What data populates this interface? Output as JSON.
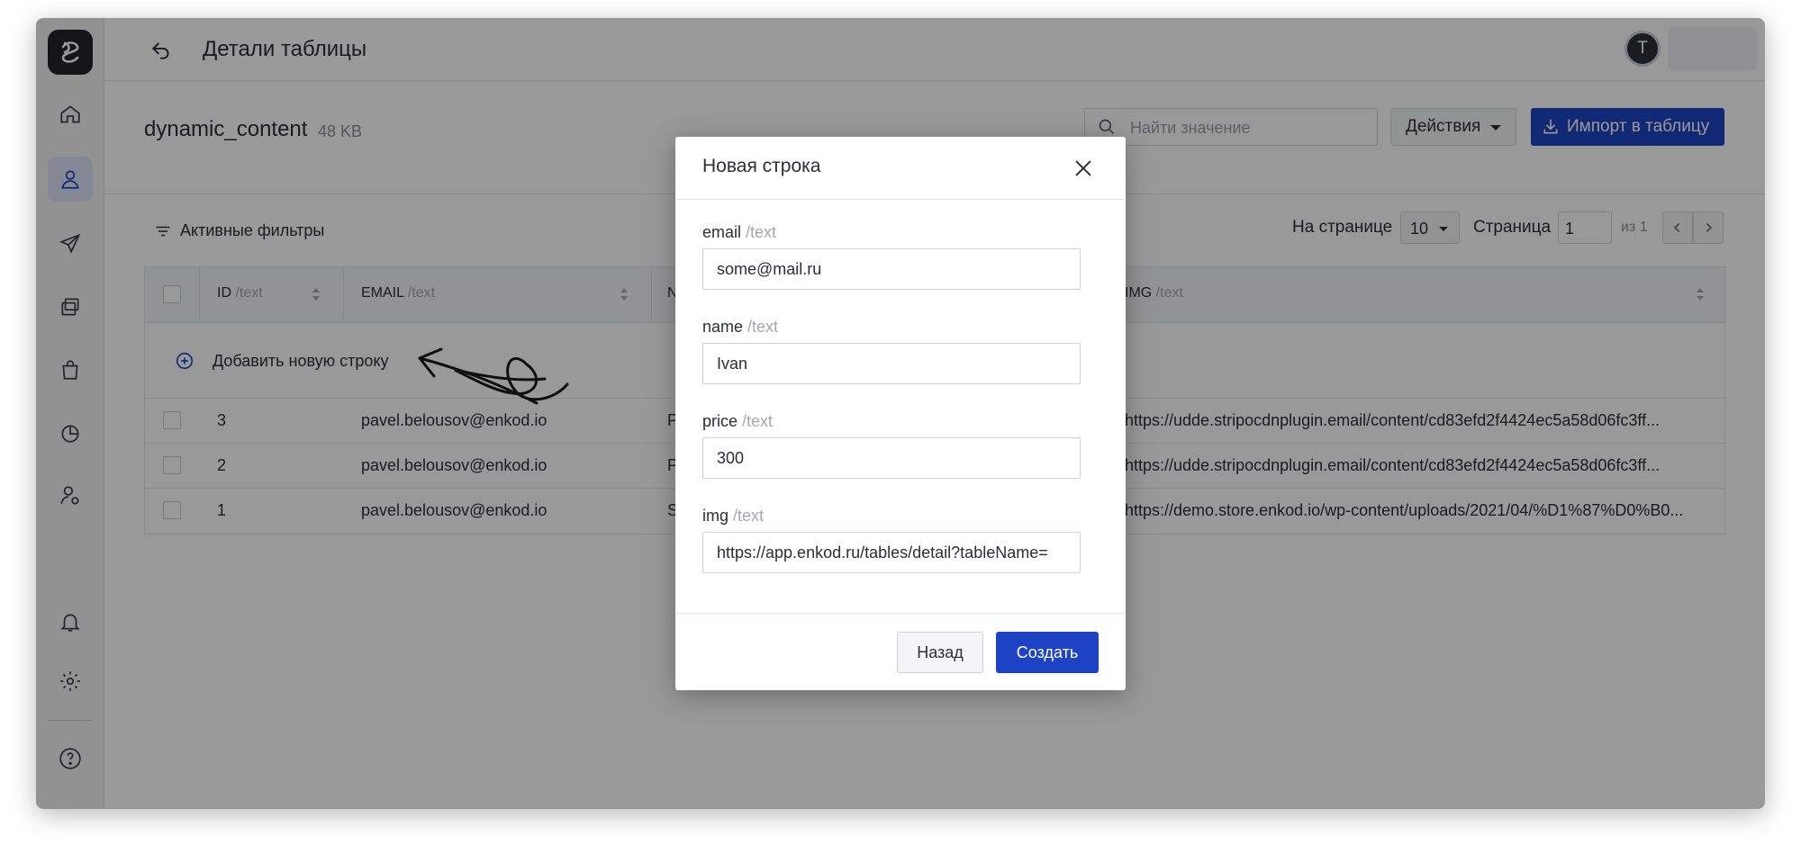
{
  "header": {
    "title": "Детали таблицы",
    "avatar_initial": "T"
  },
  "table_info": {
    "name": "dynamic_content",
    "size": "48 KB"
  },
  "toolbar": {
    "search_placeholder": "Найти значение",
    "actions_label": "Действия",
    "import_label": "Импорт в таблицу"
  },
  "filters": {
    "label": "Активные фильтры"
  },
  "pagination": {
    "per_page_label": "На странице",
    "per_page_value": "10",
    "page_label": "Страница",
    "page_value": "1",
    "of_label": "из 1"
  },
  "table": {
    "columns": [
      {
        "name": "ID",
        "type": "/text"
      },
      {
        "name": "EMAIL",
        "type": "/text"
      },
      {
        "name": "N",
        "type": ""
      },
      {
        "name": "IMG",
        "type": "/text"
      }
    ],
    "add_row_label": "Добавить новую строку",
    "rows": [
      {
        "id": "3",
        "email": "pavel.belousov@enkod.io",
        "name": "P",
        "img": "https://udde.stripocdnplugin.email/content/cd83efd2f4424ec5a58d06fc3ff..."
      },
      {
        "id": "2",
        "email": "pavel.belousov@enkod.io",
        "name": "P",
        "img": "https://udde.stripocdnplugin.email/content/cd83efd2f4424ec5a58d06fc3ff..."
      },
      {
        "id": "1",
        "email": "pavel.belousov@enkod.io",
        "name": "S",
        "img": "https://demo.store.enkod.io/wp-content/uploads/2021/04/%D1%87%D0%B0..."
      }
    ]
  },
  "modal": {
    "title": "Новая строка",
    "fields": [
      {
        "label": "email",
        "type": "/text",
        "value": "some@mail.ru"
      },
      {
        "label": "name",
        "type": "/text",
        "value": "Ivan"
      },
      {
        "label": "price",
        "type": "/text",
        "value": "300"
      },
      {
        "label": "img",
        "type": "/text",
        "value": "https://app.enkod.ru/tables/detail?tableName="
      }
    ],
    "back_label": "Назад",
    "create_label": "Создать"
  },
  "colors": {
    "primary": "#1d43c4",
    "overlay": "rgba(0,0,0,0.40)"
  },
  "icons": [
    "logo-icon",
    "home-icon",
    "user-icon",
    "send-icon",
    "copy-icon",
    "bag-icon",
    "chart-icon",
    "user-settings-icon",
    "bell-icon",
    "gear-icon",
    "help-icon",
    "back-arrow-icon",
    "search-icon",
    "download-icon",
    "filter-icon",
    "plus-circle-icon",
    "close-icon"
  ]
}
